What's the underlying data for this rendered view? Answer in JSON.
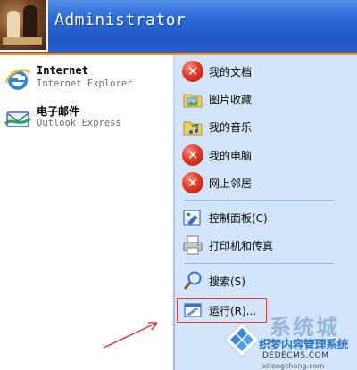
{
  "header": {
    "user_name": "Administrator"
  },
  "pinned": [
    {
      "title": "Internet",
      "subtitle": "Internet Explorer",
      "icon": "ie-icon"
    },
    {
      "title": "电子邮件",
      "subtitle": "Outlook Express",
      "icon": "outlook-icon"
    }
  ],
  "right_menu": {
    "documents": "我的文档",
    "pictures": "图片收藏",
    "music": "我的音乐",
    "computer": "我的电脑",
    "network": "网上邻居",
    "control_panel": "控制面板(C)",
    "printers": "打印机和传真",
    "search": "搜索(S)",
    "run": "运行(R)..."
  },
  "watermark": {
    "brand_large": "系统城",
    "brand_cn": "织梦内容管理系统",
    "url": "DEDECMS.COM",
    "domain": "xitongcheng.com"
  },
  "colors": {
    "header_blue": "#2d6ad6",
    "right_pane": "#d3e5fa",
    "highlight_red": "#e03b3b",
    "header_orange": "#e9902c"
  }
}
